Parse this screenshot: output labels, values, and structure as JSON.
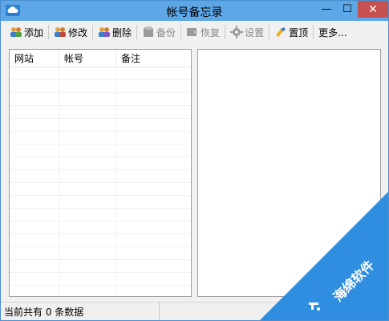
{
  "window": {
    "title": "帐号备忘录",
    "controls": {
      "minimize": "—",
      "maximize": "☐",
      "close": "✕"
    }
  },
  "toolbar": {
    "items": [
      {
        "label": "添加",
        "icon": "users-add-icon",
        "enabled": true
      },
      {
        "label": "修改",
        "icon": "users-edit-icon",
        "enabled": true
      },
      {
        "label": "删除",
        "icon": "users-delete-icon",
        "enabled": true
      },
      {
        "label": "备份",
        "icon": "backup-icon",
        "enabled": false
      },
      {
        "label": "恢复",
        "icon": "restore-icon",
        "enabled": false
      },
      {
        "label": "设置",
        "icon": "gear-icon",
        "enabled": false
      },
      {
        "label": "置顶",
        "icon": "pin-top-icon",
        "enabled": true
      },
      {
        "label": "更多...",
        "icon": "",
        "enabled": true
      }
    ]
  },
  "list": {
    "columns": [
      "网站",
      "帐号",
      "备注"
    ],
    "rows": []
  },
  "status": {
    "text": "当前共有 0 条数据",
    "count": 0
  },
  "watermark": {
    "text": "海绵软件"
  },
  "colors": {
    "titlebar": "#5ea7e6",
    "close_button": "#c75050",
    "watermark": "#2f8ee0"
  }
}
